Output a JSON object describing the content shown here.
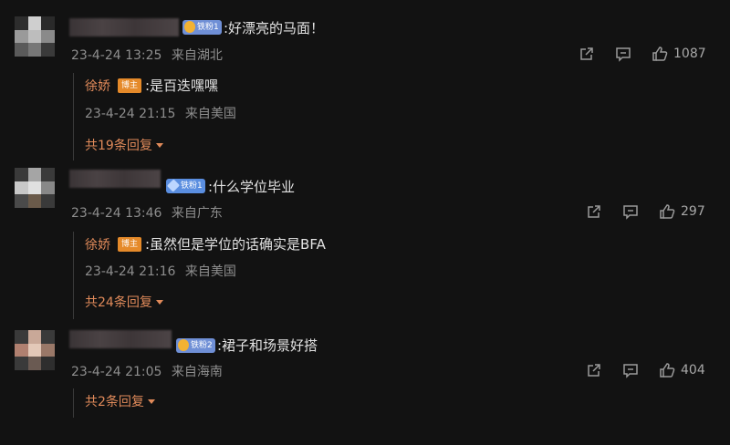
{
  "comments": [
    {
      "badge": "铁粉1",
      "badge_type": "gold",
      "text": ":好漂亮的马面！",
      "time": "23-4-24 13:25",
      "location": "来自湖北",
      "likes": "1087",
      "reply": {
        "author": "徐娇",
        "role": "博主",
        "text": ":是百迭嘿嘿",
        "time": "23-4-24 21:15",
        "location": "来自美国"
      },
      "more_replies": "共19条回复"
    },
    {
      "badge": "铁粉1",
      "badge_type": "blue",
      "text": ":什么学位毕业",
      "time": "23-4-24 13:46",
      "location": "来自广东",
      "likes": "297",
      "reply": {
        "author": "徐娇",
        "role": "博主",
        "text": ":虽然但是学位的话确实是BFA",
        "time": "23-4-24 21:16",
        "location": "来自美国"
      },
      "more_replies": "共24条回复"
    },
    {
      "badge": "铁粉2",
      "badge_type": "gold",
      "text": ":裙子和场景好搭",
      "time": "23-4-24 21:05",
      "location": "来自海南",
      "likes": "404",
      "more_replies": "共2条回复"
    }
  ],
  "colors": {
    "background": "#121212",
    "reply_author": "#e08a5a",
    "host_badge": "#e58a2a",
    "meta_text": "#8e8e8e"
  },
  "icons": [
    "share-icon",
    "comment-icon",
    "like-icon",
    "caret-down-icon"
  ]
}
